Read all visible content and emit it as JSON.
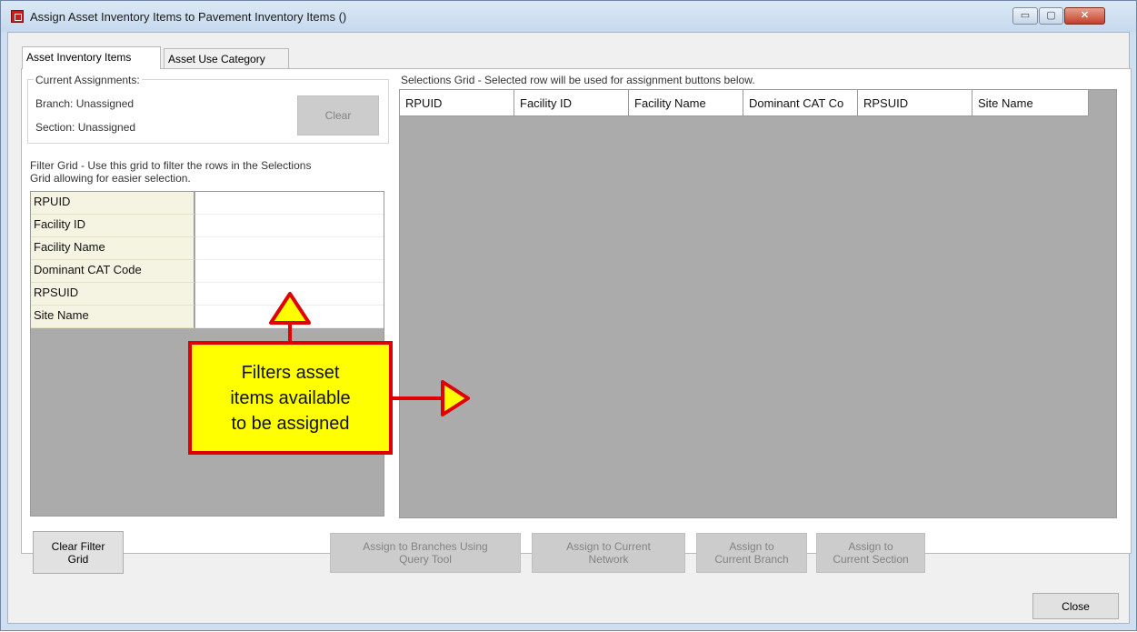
{
  "window": {
    "title": "Assign Asset Inventory Items to Pavement Inventory Items ()",
    "controls": {
      "minimize": "▭",
      "maximize": "▢",
      "close": "✕"
    }
  },
  "tabs": [
    {
      "label": "Asset Inventory Items",
      "active": true
    },
    {
      "label": "Asset Use Category",
      "active": false
    }
  ],
  "current_assignments": {
    "title": "Current Assignments:",
    "branch": "Branch: Unassigned",
    "section": "Section: Unassigned",
    "clear_label": "Clear"
  },
  "filter_grid": {
    "description_line1": "Filter Grid - Use this grid to filter the rows in the Selections",
    "description_line2": "Grid allowing for easier selection.",
    "rows": [
      "RPUID",
      "Facility ID",
      "Facility Name",
      "Dominant CAT Code",
      "RPSUID",
      "Site Name"
    ]
  },
  "selections_grid": {
    "description": "Selections Grid - Selected row will be used for assignment buttons below.",
    "columns": [
      "RPUID",
      "Facility ID",
      "Facility Name",
      "Dominant CAT Co",
      "RPSUID",
      "Site Name"
    ]
  },
  "buttons": {
    "clear_filter_line1": "Clear Filter",
    "clear_filter_line2": "Grid",
    "assign_query_line1": "Assign to Branches Using",
    "assign_query_line2": "Query Tool",
    "assign_network_line1": "Assign to Current",
    "assign_network_line2": "Network",
    "assign_branch_line1": "Assign to",
    "assign_branch_line2": "Current Branch",
    "assign_section_line1": "Assign to",
    "assign_section_line2": "Current Section",
    "close": "Close"
  },
  "callout": {
    "line1": "Filters asset",
    "line2": "items available",
    "line3": "to be assigned"
  },
  "colors": {
    "callout_fill": "#ffff00",
    "callout_border": "#e00000",
    "grid_background": "#ababab",
    "filter_name_cell": "#f5f3e2"
  }
}
